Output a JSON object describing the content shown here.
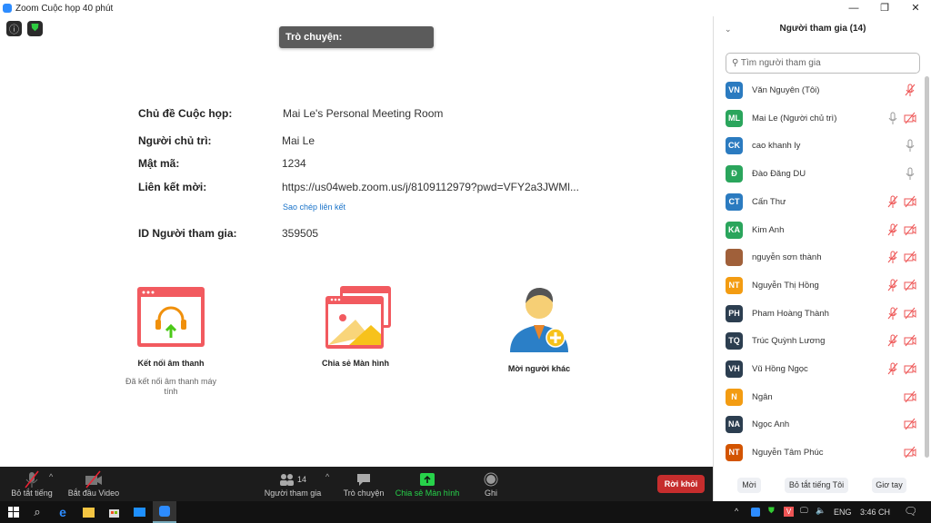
{
  "window": {
    "title": "Zoom Cuộc họp 40 phút",
    "minimize": "—",
    "restore": "❐",
    "close": "✕"
  },
  "chat_tooltip": "Trò chuyện:",
  "info": [
    {
      "label": "Chủ đề Cuộc họp:",
      "value": "Mai Le's Personal Meeting Room"
    },
    {
      "label": "Người chủ trì:",
      "value": "Mai Le"
    },
    {
      "label": "Mật mã:",
      "value": "1234"
    },
    {
      "label": "Liên kết mời:",
      "value": "https://us04web.zoom.us/j/8109112979?pwd=VFY2a3JWMl..."
    },
    {
      "label": "ID Người tham gia:",
      "value": "359505"
    }
  ],
  "copy_link": "Sao chép liên kết",
  "actions": {
    "audio": "Kết nối âm thanh",
    "audio_sub": "Đã kết nối âm thanh máy tính",
    "share": "Chia sẻ Màn hình",
    "invite": "Mời người khác"
  },
  "toolbar": {
    "mute": "Bỏ tắt tiếng",
    "video": "Bắt đầu Video",
    "participants": "Người tham gia",
    "participants_count": "14",
    "chat": "Trò chuyện",
    "share": "Chia sẻ Màn hình",
    "record": "Ghi",
    "leave": "Rời khỏi"
  },
  "panel": {
    "title": "Người tham gia (14)",
    "search_placeholder": "Tìm người tham gia",
    "invite": "Mời",
    "mute_me": "Bỏ tắt tiếng Tôi",
    "raise_hand": "Giơ tay",
    "participants": [
      {
        "initials": "VN",
        "name": "Văn Nguyên (Tôi)",
        "color": "#2b7bc0",
        "mic": "muted",
        "video": "none"
      },
      {
        "initials": "ML",
        "name": "Mai Le (Người chủ trì)",
        "color": "#2aa55c",
        "mic": "on",
        "video": "off"
      },
      {
        "initials": "CK",
        "name": "cao khanh ly",
        "color": "#2b7bc0",
        "mic": "on",
        "video": "none"
      },
      {
        "initials": "Đ",
        "name": "Đào Đăng DU",
        "color": "#2aa55c",
        "mic": "on",
        "video": "none"
      },
      {
        "initials": "CT",
        "name": "Cấn Thư",
        "color": "#2b7bc0",
        "mic": "muted",
        "video": "off"
      },
      {
        "initials": "KA",
        "name": "Kim Anh",
        "color": "#2aa55c",
        "mic": "muted",
        "video": "off"
      },
      {
        "initials": "",
        "name": "nguyễn sơn thành",
        "color": "#a0603a",
        "mic": "muted",
        "video": "off"
      },
      {
        "initials": "NT",
        "name": "Nguyễn Thị Hồng",
        "color": "#f39c12",
        "mic": "muted",
        "video": "off"
      },
      {
        "initials": "PH",
        "name": "Pham Hoàng Thành",
        "color": "#2c3e50",
        "mic": "muted",
        "video": "off"
      },
      {
        "initials": "TQ",
        "name": "Trúc Quỳnh Lương",
        "color": "#2c3e50",
        "mic": "muted",
        "video": "off"
      },
      {
        "initials": "VH",
        "name": "Vũ Hồng Ngọc",
        "color": "#2c3e50",
        "mic": "muted",
        "video": "off"
      },
      {
        "initials": "N",
        "name": "Ngân",
        "color": "#f39c12",
        "mic": "none",
        "video": "off"
      },
      {
        "initials": "NA",
        "name": "Ngọc Anh",
        "color": "#2c3e50",
        "mic": "none",
        "video": "off"
      },
      {
        "initials": "NT",
        "name": "Nguyễn Tâm Phúc",
        "color": "#d35400",
        "mic": "none",
        "video": "off"
      }
    ]
  },
  "taskbar": {
    "lang": "ENG",
    "time": "3:46 CH"
  }
}
